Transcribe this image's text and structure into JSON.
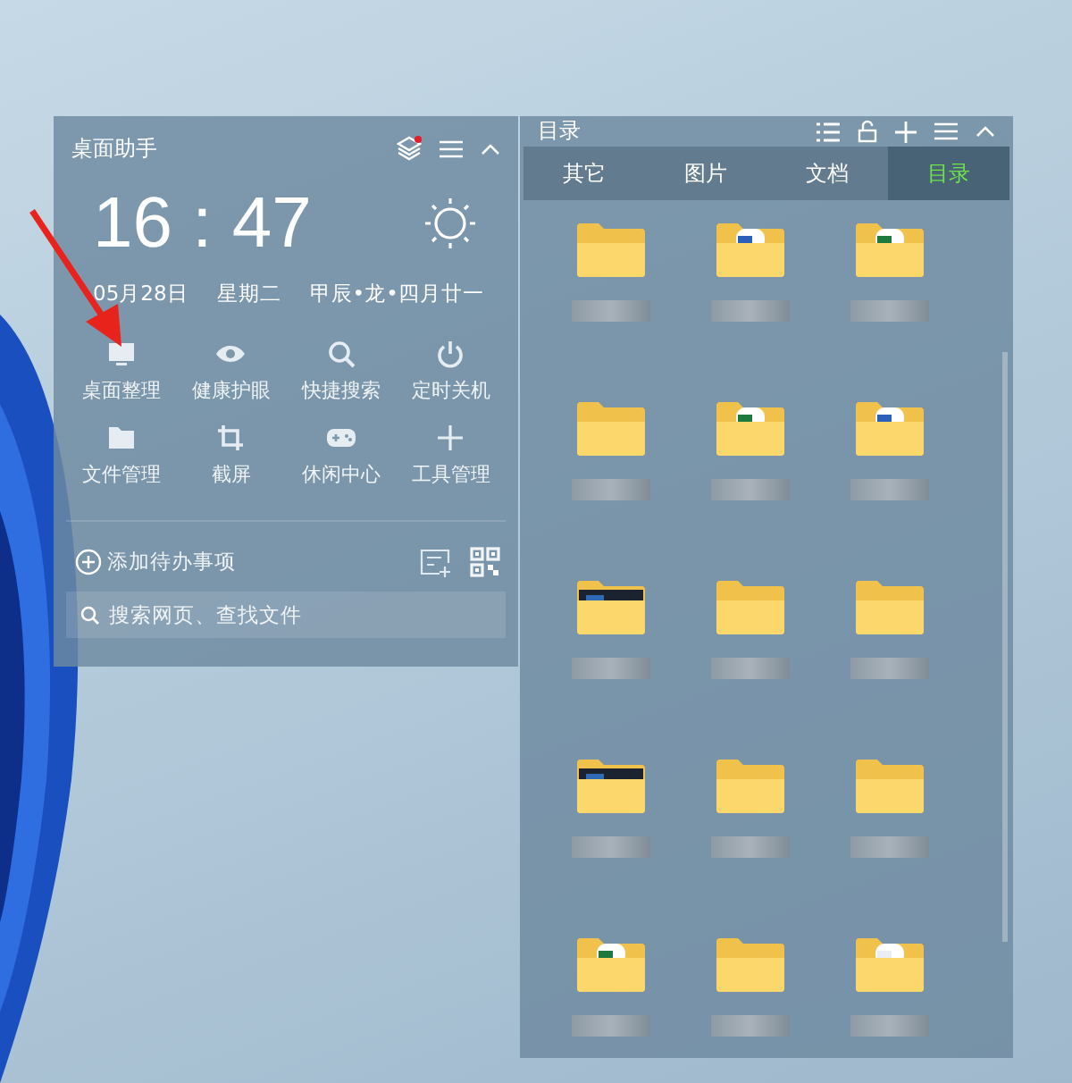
{
  "assistant": {
    "title": "桌面助手",
    "time": "16 : 47",
    "date": "05月28日",
    "weekday": "星期二",
    "lunar": "甲辰•龙•四月廿一",
    "notification": true,
    "tools": [
      "桌面整理",
      "健康护眼",
      "快捷搜索",
      "定时关机",
      "文件管理",
      "截屏",
      "休闲中心",
      "工具管理"
    ],
    "todo": "添加待办事项",
    "search": {
      "placeholder": "搜索网页、查找文件"
    }
  },
  "catalog": {
    "title": "目录",
    "tabs": [
      {
        "label": "其它",
        "selected": false
      },
      {
        "label": "图片",
        "selected": false
      },
      {
        "label": "文档",
        "selected": false
      },
      {
        "label": "目录",
        "selected": true
      }
    ],
    "folders": [
      {
        "kind": "plain"
      },
      {
        "kind": "bluedoc"
      },
      {
        "kind": "greendoc"
      },
      {
        "kind": "plain"
      },
      {
        "kind": "greendoc"
      },
      {
        "kind": "bluedoc"
      },
      {
        "kind": "photo"
      },
      {
        "kind": "plain"
      },
      {
        "kind": "plain"
      },
      {
        "kind": "photo"
      },
      {
        "kind": "plain"
      },
      {
        "kind": "plain"
      },
      {
        "kind": "greendoc"
      },
      {
        "kind": "plain"
      },
      {
        "kind": "whitedoc"
      }
    ]
  }
}
